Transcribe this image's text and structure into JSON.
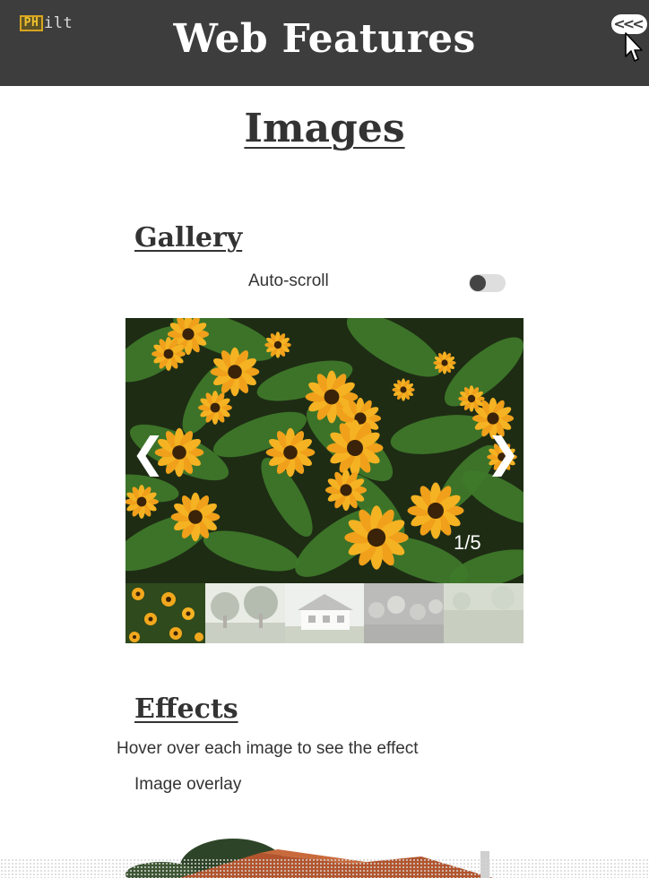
{
  "header": {
    "logo_mark": "PH",
    "logo_text": "ilt",
    "title": "Web Features",
    "back_button": "<<<",
    "icons": {
      "back": "triple-chevron-left-icon",
      "cursor": "mouse-pointer-icon"
    }
  },
  "page": {
    "heading": "Images"
  },
  "gallery": {
    "heading": "Gallery",
    "autoscroll_label": "Auto-scroll",
    "autoscroll_enabled": false,
    "prev_arrow": "❮",
    "next_arrow": "❯",
    "counter": "1/5",
    "current_index": 1,
    "total": 5,
    "thumbnails": [
      {
        "name": "thumb-flowers",
        "active": true
      },
      {
        "name": "thumb-trees",
        "active": false
      },
      {
        "name": "thumb-house",
        "active": false
      },
      {
        "name": "thumb-crowd",
        "active": false
      },
      {
        "name": "thumb-field",
        "active": false
      }
    ]
  },
  "effects": {
    "heading": "Effects",
    "intro": "Hover over each image to see the effect",
    "overlay_label": "Image overlay"
  },
  "colors": {
    "header_bg": "#3d3d3d",
    "text": "#333333",
    "flower_petal": "#f2a81d",
    "leaf": "#3f7a2a"
  }
}
